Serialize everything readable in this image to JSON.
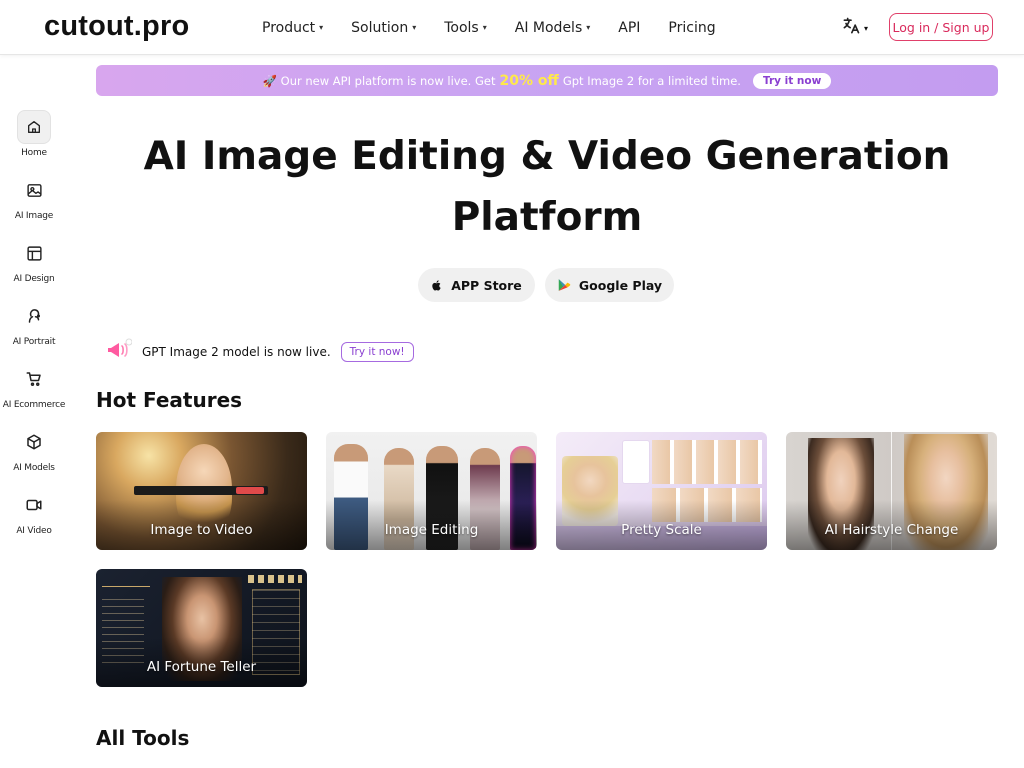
{
  "header": {
    "logo": "cutout.pro",
    "nav": [
      {
        "label": "Product",
        "chevron": true
      },
      {
        "label": "Solution",
        "chevron": true
      },
      {
        "label": "Tools",
        "chevron": true
      },
      {
        "label": "AI Models",
        "chevron": true
      },
      {
        "label": "API",
        "chevron": false
      },
      {
        "label": "Pricing",
        "chevron": false
      }
    ],
    "language_icon": "translate-icon",
    "login_label": "Log in / Sign up"
  },
  "sidebar": {
    "items": [
      {
        "label": "Home",
        "icon": "home-icon",
        "active": true
      },
      {
        "label": "AI Image",
        "icon": "image-icon"
      },
      {
        "label": "AI Design",
        "icon": "layout-icon"
      },
      {
        "label": "AI Portrait",
        "icon": "portrait-icon"
      },
      {
        "label": "AI Ecommerce",
        "icon": "cart-icon"
      },
      {
        "label": "AI Models",
        "icon": "cube-icon"
      },
      {
        "label": "AI Video",
        "icon": "video-icon"
      }
    ]
  },
  "banner": {
    "prefix": "🚀 Our new API platform is now live. Get",
    "highlight": "20% off",
    "suffix": "Gpt Image 2 for a limited time.",
    "cta": "Try it now"
  },
  "hero": {
    "title_line1": "AI Image Editing & Video Generation",
    "title_line2": "Platform",
    "app_store": "APP Store",
    "google_play": "Google Play"
  },
  "announcement": {
    "text": "GPT Image 2 model is now live.",
    "cta": "Try it now!"
  },
  "hot_features": {
    "heading": "Hot Features",
    "cards": [
      {
        "label": "Image to Video"
      },
      {
        "label": "Image Editing"
      },
      {
        "label": "Pretty Scale"
      },
      {
        "label": "AI Hairstyle Change"
      },
      {
        "label": "AI Fortune Teller"
      }
    ]
  },
  "all_tools": {
    "heading": "All Tools"
  }
}
